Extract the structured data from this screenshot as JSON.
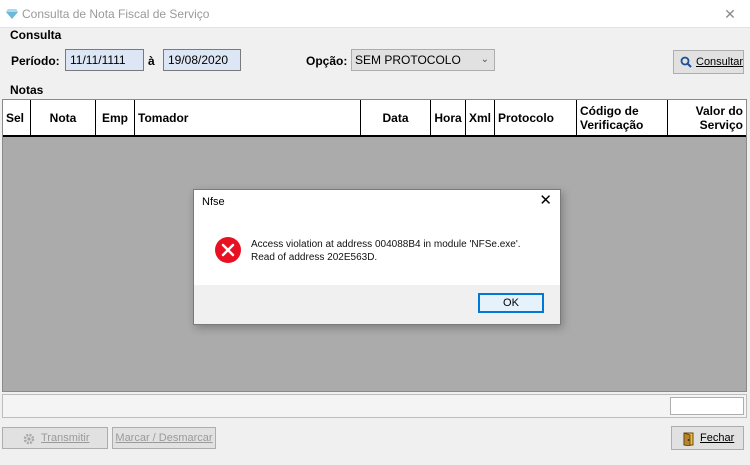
{
  "window": {
    "title": "Consulta de Nota Fiscal de Serviço",
    "close_glyph": "✕"
  },
  "consulta": {
    "section_label": "Consulta",
    "periodo_label": "Período:",
    "date_from": "11/11/1111",
    "separator": "à",
    "date_to": "19/08/2020",
    "opcao_label": "Opção:",
    "opcao_value": "SEM PROTOCOLO",
    "consultar_button": "Consultar"
  },
  "notas": {
    "section_label": "Notas",
    "columns": [
      "Sel",
      "Nota",
      "Emp",
      "Tomador",
      "Data",
      "Hora",
      "Xml",
      "Protocolo",
      "Código de Verificação",
      "Valor do Serviço"
    ]
  },
  "footer": {
    "transmitir_button": "Transmitir",
    "marcar_button": "Marcar / Desmarcar",
    "fechar_button": "Fechar"
  },
  "dialog": {
    "title": "Nfse",
    "close_glyph": "✕",
    "message_line1": "Access violation at address 004088B4 in module 'NFSe.exe'.",
    "message_line2": "Read of address 202E563D.",
    "ok_button": "OK"
  },
  "colors": {
    "grid_background": "#ababab",
    "date_field": "#dde6f5",
    "error_red": "#e81123",
    "focus_blue": "#0078d7"
  }
}
